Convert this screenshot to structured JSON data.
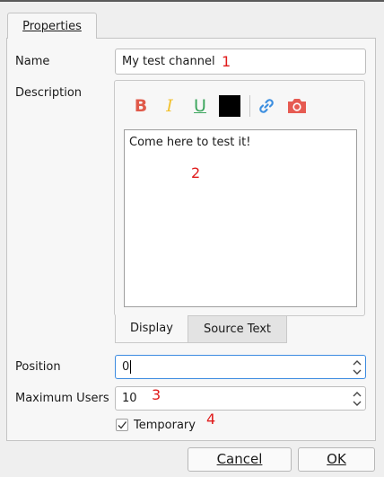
{
  "tabs": {
    "properties": "Properties"
  },
  "form": {
    "name_label": "Name",
    "name_value": "My test channel",
    "description_label": "Description",
    "description_text": "Come here to test it!",
    "description_tabs": {
      "display": "Display",
      "source": "Source Text"
    },
    "position_label": "Position",
    "position_value": "0",
    "max_users_label": "Maximum Users",
    "max_users_value": "10",
    "temporary_label": "Temporary",
    "temporary_checked": true
  },
  "toolbar": {
    "bold": "B",
    "italic": "I",
    "underline": "U",
    "icons": [
      "bold-icon",
      "italic-icon",
      "underline-icon",
      "text-color-swatch",
      "link-icon",
      "camera-icon"
    ],
    "colors": {
      "bold": "#e05a4a",
      "italic": "#f2c230",
      "underline": "#3ba55c",
      "swatch": "#000000",
      "link": "#3d8fe0",
      "camera": "#e65b52"
    }
  },
  "annotations": [
    "1",
    "2",
    "3",
    "4"
  ],
  "buttons": {
    "cancel": "Cancel",
    "ok": "OK"
  }
}
